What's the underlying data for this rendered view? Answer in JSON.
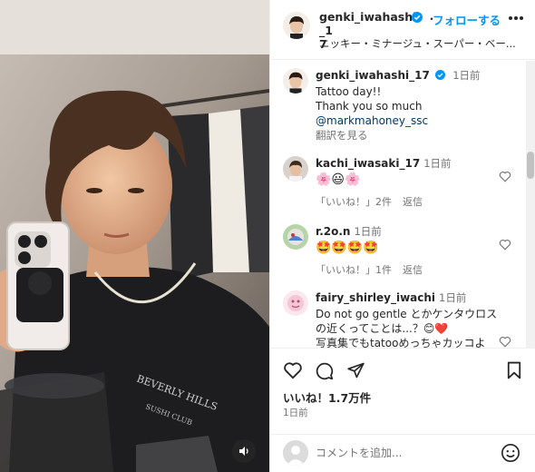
{
  "post": {
    "username": "genki_iwahashi_17",
    "username_wrapped": "genki_iwahashi_1\n7",
    "follow_label": "フォローする",
    "separator": "・",
    "audio_subtitle": "ニッキー・ミナージュ・スーパー・ベー..."
  },
  "caption": {
    "username": "genki_iwahashi_17",
    "time": "1日前",
    "line1": "Tattoo day!!",
    "line2": "Thank you so much",
    "mention": "@markmahoney_ssc",
    "translate": "翻訳を見る"
  },
  "comments": [
    {
      "username": "kachi_iwasaki_17",
      "time": "1日前",
      "text": "🌸😃🌸",
      "likes_label": "「いいね！」2件",
      "reply_label": "返信"
    },
    {
      "username": "r.2o.n",
      "time": "1日前",
      "text": "🤩🤩🤩🤩",
      "likes_label": "「いいね！」1件",
      "reply_label": "返信"
    },
    {
      "username": "fairy_shirley_iwachi",
      "time": "1日前",
      "text_line1": "Do not go gentle とかケンタウロス",
      "text_line2": "の近くってことは...？😊❤️",
      "text_line3": "写真集でもtatooめっちゃカッコよ"
    }
  ],
  "likes": {
    "label": "いいね！1.7万件"
  },
  "date": "1日前",
  "add_comment": {
    "placeholder": "コメントを追加..."
  },
  "colors": {
    "accent_blue": "#0095f6",
    "verified_blue": "#0095f6",
    "text_primary": "#262626",
    "text_secondary": "#737373",
    "border": "#efefef"
  }
}
